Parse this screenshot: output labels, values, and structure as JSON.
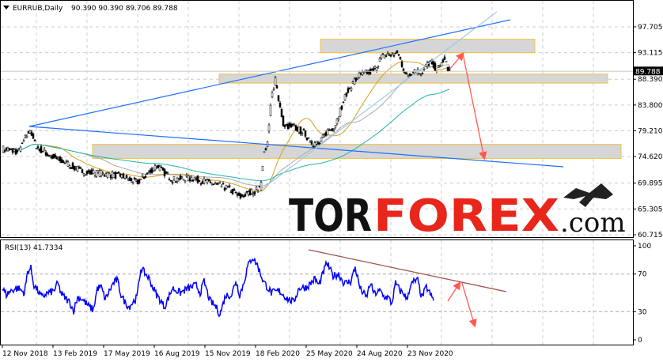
{
  "header": {
    "symbol": "EURRUB,Daily",
    "ohlc": "90.390 90.390 89.706 89.788"
  },
  "chart_data": {
    "type": "candlestick",
    "title": "EURRUB,Daily",
    "current_price": "89.788",
    "price_ticks": [
      "97.705",
      "93.115",
      "88.390",
      "83.800",
      "79.210",
      "74.620",
      "69.895",
      "65.305",
      "60.715"
    ],
    "ylim": [
      60.715,
      97.705
    ],
    "date_ticks": [
      "12 Nov 2018",
      "13 Feb 2019",
      "17 May 2019",
      "16 Aug 2019",
      "15 Nov 2019",
      "18 Feb 2020",
      "25 May 2020",
      "24 Aug 2020",
      "23 Nov 2020"
    ],
    "price_path": [
      [
        0,
        76
      ],
      [
        20,
        75.5
      ],
      [
        35,
        79.5
      ],
      [
        42,
        76.5
      ],
      [
        60,
        74.8
      ],
      [
        80,
        73.5
      ],
      [
        100,
        72
      ],
      [
        130,
        71.5
      ],
      [
        150,
        71.2
      ],
      [
        170,
        70
      ],
      [
        195,
        73
      ],
      [
        215,
        70.5
      ],
      [
        240,
        70.8
      ],
      [
        260,
        70
      ],
      [
        285,
        69
      ],
      [
        300,
        67.5
      ],
      [
        318,
        68.5
      ],
      [
        326,
        69
      ],
      [
        330,
        75
      ],
      [
        335,
        77
      ],
      [
        340,
        85
      ],
      [
        345,
        88.5
      ],
      [
        350,
        84
      ],
      [
        356,
        80
      ],
      [
        366,
        80
      ],
      [
        380,
        79
      ],
      [
        392,
        77
      ],
      [
        400,
        76.8
      ],
      [
        410,
        79
      ],
      [
        420,
        80
      ],
      [
        435,
        86
      ],
      [
        450,
        89
      ],
      [
        470,
        90
      ],
      [
        480,
        92.5
      ],
      [
        500,
        93
      ],
      [
        510,
        89
      ],
      [
        520,
        90
      ],
      [
        530,
        89.5
      ],
      [
        540,
        91.5
      ],
      [
        550,
        90
      ],
      [
        558,
        92
      ],
      [
        565,
        89.8
      ]
    ],
    "rsi": {
      "label": "RSI(13) 41.7334",
      "ticks": [
        "100",
        "70",
        "30",
        "0"
      ],
      "levels": [
        70,
        30
      ],
      "path": [
        [
          0,
          55
        ],
        [
          5,
          48
        ],
        [
          12,
          53
        ],
        [
          20,
          55
        ],
        [
          28,
          50
        ],
        [
          32,
          73
        ],
        [
          36,
          76
        ],
        [
          40,
          58
        ],
        [
          45,
          52
        ],
        [
          50,
          45
        ],
        [
          55,
          49
        ],
        [
          65,
          52
        ],
        [
          70,
          60
        ],
        [
          75,
          48
        ],
        [
          85,
          40
        ],
        [
          90,
          31
        ],
        [
          95,
          45
        ],
        [
          100,
          44
        ],
        [
          110,
          35
        ],
        [
          115,
          32
        ],
        [
          120,
          55
        ],
        [
          125,
          56
        ],
        [
          130,
          43
        ],
        [
          140,
          60
        ],
        [
          145,
          64
        ],
        [
          150,
          48
        ],
        [
          155,
          40
        ],
        [
          160,
          35
        ],
        [
          170,
          45
        ],
        [
          175,
          76
        ],
        [
          185,
          66
        ],
        [
          190,
          56
        ],
        [
          195,
          48
        ],
        [
          205,
          35
        ],
        [
          215,
          55
        ],
        [
          225,
          50
        ],
        [
          235,
          55
        ],
        [
          245,
          58
        ],
        [
          250,
          50
        ],
        [
          255,
          62
        ],
        [
          262,
          42
        ],
        [
          270,
          35
        ],
        [
          275,
          27
        ],
        [
          282,
          47
        ],
        [
          290,
          48
        ],
        [
          295,
          63
        ],
        [
          300,
          48
        ],
        [
          305,
          60
        ],
        [
          310,
          78
        ],
        [
          316,
          88
        ],
        [
          322,
          80
        ],
        [
          330,
          62
        ],
        [
          340,
          50
        ],
        [
          350,
          52
        ],
        [
          360,
          44
        ],
        [
          368,
          40
        ],
        [
          375,
          55
        ],
        [
          385,
          56
        ],
        [
          395,
          65
        ],
        [
          400,
          58
        ],
        [
          410,
          82
        ],
        [
          418,
          68
        ],
        [
          425,
          70
        ],
        [
          432,
          60
        ],
        [
          440,
          62
        ],
        [
          446,
          77
        ],
        [
          452,
          55
        ],
        [
          460,
          45
        ],
        [
          465,
          60
        ],
        [
          470,
          49
        ],
        [
          478,
          52
        ],
        [
          482,
          46
        ],
        [
          488,
          45
        ],
        [
          492,
          38
        ],
        [
          497,
          60
        ],
        [
          503,
          52
        ],
        [
          508,
          49
        ],
        [
          511,
          42
        ],
        [
          515,
          56
        ],
        [
          520,
          62
        ],
        [
          525,
          63
        ],
        [
          530,
          45
        ],
        [
          536,
          56
        ],
        [
          540,
          50
        ],
        [
          545,
          41.7
        ]
      ]
    },
    "boxes": [
      {
        "top": 95.5,
        "bottom": 93.1
      },
      {
        "top": 89.3,
        "bottom": 87.7
      },
      {
        "top": 76.8,
        "bottom": 74.3
      }
    ]
  },
  "logo": {
    "tor": "TOR",
    "forex": "FOREX",
    "com": ".com"
  },
  "colors": {
    "candle": "#000000",
    "ma_fast": "#d4a017",
    "ma_mid": "#a9a9a9",
    "ma_slow": "#20b2aa",
    "trend": "#1e6fff",
    "rsi": "#0000ff",
    "arrow": "#ff5a4f",
    "logo_red": "#e8261c"
  }
}
